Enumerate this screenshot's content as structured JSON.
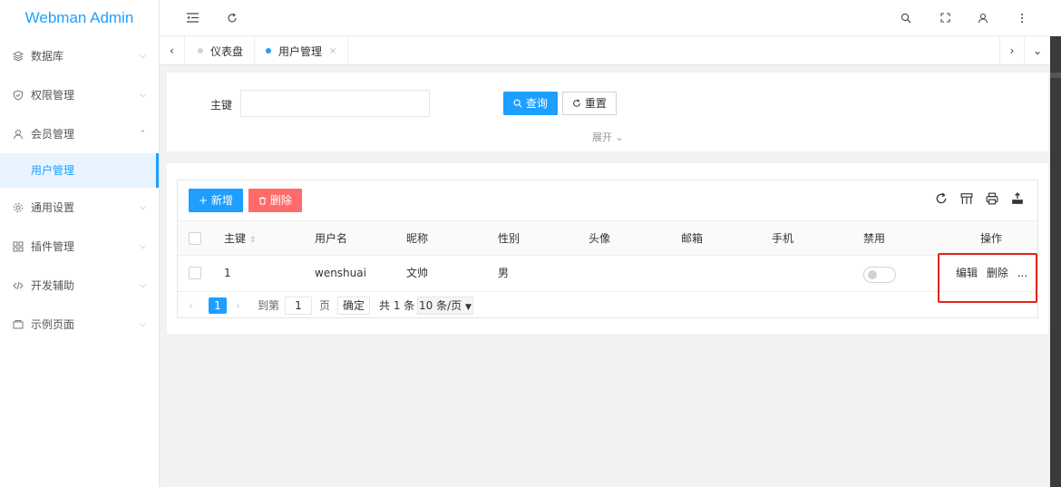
{
  "app": {
    "title": "Webman Admin"
  },
  "sidebar": {
    "items": [
      {
        "label": "数据库",
        "icon": "layers-icon",
        "expanded": false
      },
      {
        "label": "权限管理",
        "icon": "shield-check-icon",
        "expanded": false
      },
      {
        "label": "会员管理",
        "icon": "user-icon",
        "expanded": true
      },
      {
        "label": "通用设置",
        "icon": "gear-icon",
        "expanded": false
      },
      {
        "label": "插件管理",
        "icon": "grid-icon",
        "expanded": false
      },
      {
        "label": "开发辅助",
        "icon": "code-icon",
        "expanded": false
      },
      {
        "label": "示例页面",
        "icon": "page-icon",
        "expanded": false
      }
    ],
    "sub_items": [
      {
        "label": "用户管理",
        "active": true
      }
    ]
  },
  "header": {
    "icons": [
      "menu-fold-icon",
      "refresh-icon",
      "search-icon",
      "fullscreen-icon",
      "user-icon",
      "more-vertical-icon"
    ]
  },
  "tabs": {
    "items": [
      {
        "label": "仪表盘",
        "active": false
      },
      {
        "label": "用户管理",
        "active": true,
        "close": "×"
      }
    ]
  },
  "search": {
    "field_label": "主键",
    "field_value": "",
    "query_button": "查询",
    "reset_button": "重置",
    "expand_label": "展开"
  },
  "toolbar": {
    "add_button": "+ 新增",
    "delete_button": "删除",
    "icons": [
      "refresh-icon",
      "columns-icon",
      "print-icon",
      "export-icon"
    ]
  },
  "table": {
    "columns": [
      "主键",
      "用户名",
      "昵称",
      "性别",
      "头像",
      "邮箱",
      "手机",
      "禁用",
      "操作"
    ],
    "rows": [
      {
        "id": "1",
        "username": "wenshuai",
        "nickname": "文帅",
        "gender": "男",
        "avatar": "",
        "email": "",
        "mobile": "",
        "disabled": false,
        "actions": {
          "edit": "编辑",
          "delete": "删除",
          "more": "..."
        }
      }
    ]
  },
  "pagination": {
    "current_page": "1",
    "goto_label": "到第",
    "goto_value": "1",
    "page_unit": "页",
    "confirm": "确定",
    "total": "共 1 条",
    "page_size": "10 条/页"
  },
  "colors": {
    "primary": "#1e9fff",
    "danger": "#ff5722",
    "highlight_border": "#e1251b"
  }
}
